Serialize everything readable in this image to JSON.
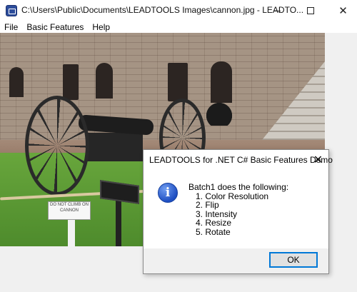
{
  "window": {
    "title": "C:\\Users\\Public\\Documents\\LEADTOOLS Images\\cannon.jpg - LEADTO...",
    "minimize_icon": "minimize-icon",
    "maximize_icon": "maximize-icon",
    "close_label": "✕"
  },
  "menu": [
    "File",
    "Basic Features",
    "Help"
  ],
  "dialog": {
    "title": "LEADTOOLS for .NET C# Basic Features Demo",
    "close_label": "✕",
    "icon_label": "i",
    "message_intro": "Batch1 does the following:",
    "steps": [
      "1. Color Resolution",
      "2. Flip",
      "3. Intensity",
      "4. Resize",
      "5. Rotate"
    ],
    "ok_label": "OK"
  },
  "image": {
    "sign_text": "DO NOT CLIMB ON CANNON"
  }
}
